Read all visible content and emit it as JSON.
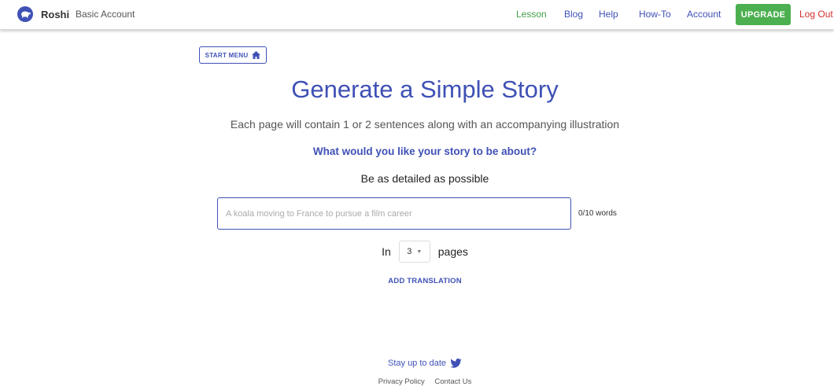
{
  "navbar": {
    "brand": "Roshi",
    "account_type": "Basic Account",
    "links": {
      "lesson": "Lesson",
      "blog": "Blog",
      "help": "Help",
      "howto": "How-To",
      "account": "Account"
    },
    "upgrade": "UPGRADE",
    "logout": "Log Out"
  },
  "start_menu": "START MENU",
  "title": "Generate a Simple Story",
  "subtitle": "Each page will contain 1 or 2 sentences along with an accompanying illustration",
  "question": "What would you like your story to be about?",
  "detail": "Be as detailed as possible",
  "story_input": {
    "value": "",
    "placeholder": "A koala moving to France to pursue a film career"
  },
  "word_count": "0/10 words",
  "pages": {
    "prefix": "In",
    "selected": "3",
    "suffix": "pages"
  },
  "add_translation": "ADD TRANSLATION",
  "footer": {
    "stay": "Stay up to date",
    "privacy": "Privacy Policy",
    "contact": "Contact Us"
  },
  "colors": {
    "primary": "#3f51b5",
    "green": "#4caf50",
    "red": "#d32f2f"
  },
  "icons": {
    "brand": "turtle-logo-icon",
    "start_menu": "home-icon",
    "twitter": "twitter-icon",
    "select": "chevron-down-icon"
  }
}
